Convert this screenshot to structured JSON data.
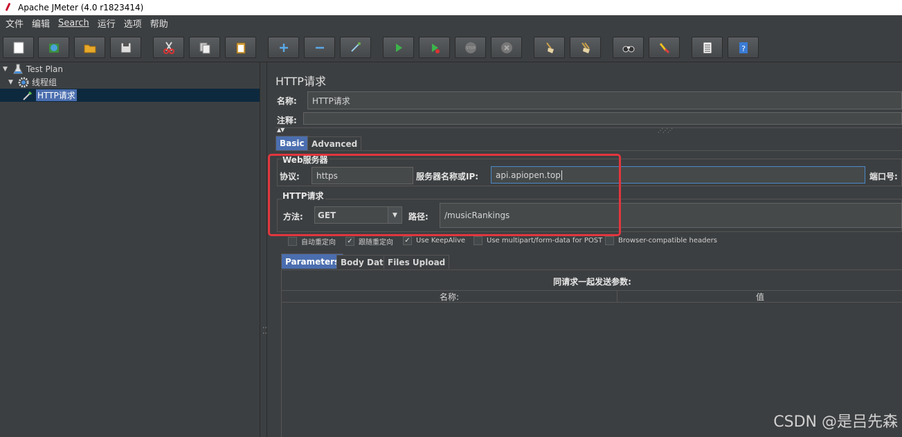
{
  "window": {
    "title": "Apache JMeter (4.0 r1823414)"
  },
  "menu": [
    "文件",
    "编辑",
    "Search",
    "运行",
    "选项",
    "帮助"
  ],
  "toolbar": [
    {
      "name": "new",
      "icon": "new-file-icon"
    },
    {
      "name": "templates",
      "icon": "templates-icon"
    },
    {
      "name": "open",
      "icon": "open-folder-icon"
    },
    {
      "name": "save",
      "icon": "save-icon"
    },
    {
      "name": "cut",
      "icon": "cut-icon"
    },
    {
      "name": "copy",
      "icon": "copy-icon"
    },
    {
      "name": "paste",
      "icon": "paste-icon"
    },
    {
      "name": "expand",
      "icon": "plus-icon"
    },
    {
      "name": "collapse",
      "icon": "minus-icon"
    },
    {
      "name": "toggle",
      "icon": "toggle-icon"
    },
    {
      "name": "start",
      "icon": "play-icon"
    },
    {
      "name": "start-no-pauses",
      "icon": "play-no-pause-icon"
    },
    {
      "name": "stop",
      "icon": "stop-icon"
    },
    {
      "name": "shutdown",
      "icon": "shutdown-icon"
    },
    {
      "name": "clear",
      "icon": "clear-broom-icon"
    },
    {
      "name": "clear-all",
      "icon": "clear-all-broom-icon"
    },
    {
      "name": "search",
      "icon": "binoculars-icon"
    },
    {
      "name": "reset-search",
      "icon": "reset-search-icon"
    },
    {
      "name": "function-helper",
      "icon": "list-icon"
    },
    {
      "name": "help",
      "icon": "help-icon"
    }
  ],
  "tree": {
    "items": [
      {
        "label": "Test Plan",
        "icon": "test-plan-flask-icon",
        "expanded": true
      },
      {
        "label": "线程组",
        "icon": "thread-group-gear-icon",
        "expanded": true
      },
      {
        "label": "HTTP请求",
        "icon": "http-sampler-pipette-icon",
        "selected": true
      }
    ]
  },
  "panel": {
    "title": "HTTP请求",
    "name_label": "名称:",
    "name_value": "HTTP请求",
    "comment_label": "注释:",
    "comment_value": "",
    "tabs": [
      "Basic",
      "Advanced"
    ],
    "active_tab": "Basic",
    "web_server": {
      "title": "Web服务器",
      "protocol_label": "协议:",
      "protocol_value": "https",
      "server_label": "服务器名称或IP:",
      "server_value": "api.apiopen.top",
      "port_label": "端口号:"
    },
    "http_request": {
      "title": "HTTP请求",
      "method_label": "方法:",
      "method_value": "GET",
      "path_label": "路径:",
      "path_value": "/musicRankings"
    },
    "options": [
      {
        "label": "自动重定向",
        "checked": false
      },
      {
        "label": "跟随重定向",
        "checked": true
      },
      {
        "label": "Use KeepAlive",
        "checked": true
      },
      {
        "label": "Use multipart/form-data for POST",
        "checked": false
      },
      {
        "label": "Browser-compatible headers",
        "checked": false
      }
    ],
    "sub_tabs": [
      "Parameters",
      "Body Data",
      "Files Upload"
    ],
    "active_sub_tab": "Parameters",
    "params_caption": "同请求一起发送参数:",
    "params_columns": [
      "名称:",
      "值"
    ]
  },
  "watermark": "CSDN @是吕先森",
  "colors": {
    "accent": "#4b6eaf",
    "highlight_box": "#e2363e",
    "background": "#3c3f41"
  }
}
